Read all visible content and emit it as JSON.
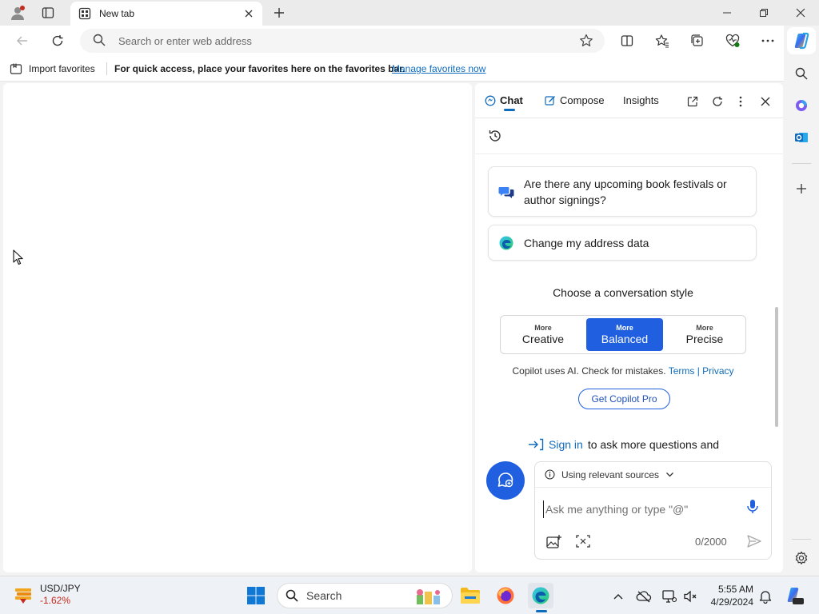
{
  "browser": {
    "tab_title": "New tab",
    "address_placeholder": "Search or enter web address"
  },
  "favorites_bar": {
    "import_label": "Import favorites",
    "message": "For quick access, place your favorites here on the favorites bar.",
    "manage_link": "Manage favorites now"
  },
  "copilot": {
    "tabs": [
      {
        "label": "Chat"
      },
      {
        "label": "Compose"
      },
      {
        "label": "Insights"
      }
    ],
    "suggestions": [
      {
        "text": "Are there any upcoming book festivals or author signings?"
      },
      {
        "text": "Change my address data"
      }
    ],
    "choose_style": "Choose a conversation style",
    "styles": [
      {
        "more": "More",
        "name": "Creative"
      },
      {
        "more": "More",
        "name": "Balanced"
      },
      {
        "more": "More",
        "name": "Precise"
      }
    ],
    "disclaimer": "Copilot uses AI. Check for mistakes.",
    "terms": "Terms",
    "separator": "|",
    "privacy": "Privacy",
    "pro_button": "Get Copilot Pro",
    "signin_link": "Sign in",
    "signin_rest": "to ask more questions and",
    "sources_label": "Using relevant sources",
    "input_placeholder": "Ask me anything or type \"@\"",
    "counter": "0/2000"
  },
  "taskbar": {
    "ticker_name": "USD/JPY",
    "ticker_change": "-1.62%",
    "search_label": "Search",
    "time": "5:55 AM",
    "date": "4/29/2024"
  },
  "colors": {
    "accent": "#1f5fe0",
    "link": "#0f6cbd",
    "negative": "#c42b1c"
  }
}
